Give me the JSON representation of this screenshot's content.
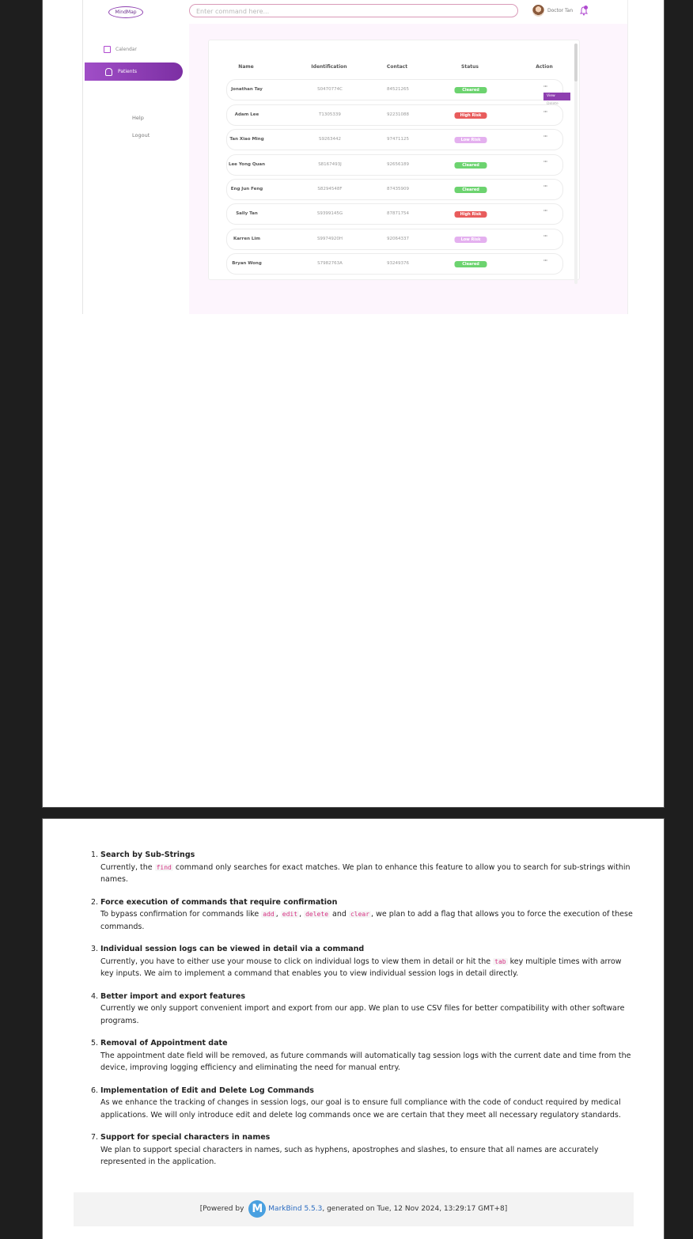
{
  "app": {
    "logo": "MindMap",
    "command_placeholder": "Enter command here...",
    "user_name": "Doctor Tan"
  },
  "sidebar": {
    "calendar": "Calendar",
    "patients": "Patients",
    "help": "Help",
    "logout": "Logout"
  },
  "table": {
    "headers": [
      "Name",
      "Identification",
      "Contact",
      "Status",
      "Action"
    ],
    "rows": [
      {
        "name": "Jonathan Tay",
        "id": "S0470774C",
        "contact": "84521265",
        "status": "Cleared"
      },
      {
        "name": "Adam Lee",
        "id": "T1305339",
        "contact": "92231088",
        "status": "High Risk"
      },
      {
        "name": "Tan Xiao Ming",
        "id": "S9263442",
        "contact": "97471125",
        "status": "Low Risk"
      },
      {
        "name": "Lee Yong Quan",
        "id": "S8167493J",
        "contact": "92656189",
        "status": "Cleared"
      },
      {
        "name": "Eng Jun Feng",
        "id": "S8294548F",
        "contact": "87435909",
        "status": "Cleared"
      },
      {
        "name": "Sally Tan",
        "id": "S9399145G",
        "contact": "87871754",
        "status": "High Risk"
      },
      {
        "name": "Karren Lim",
        "id": "S9974920H",
        "contact": "92064337",
        "status": "Low Risk"
      },
      {
        "name": "Bryan Wong",
        "id": "S7982763A",
        "contact": "93249376",
        "status": "Cleared"
      }
    ],
    "action_glyph": "···",
    "menu_view": "View",
    "menu_delete": "Delete"
  },
  "status_colors": {
    "Cleared": "#6cd36f",
    "High Risk": "#e85c5c",
    "Low Risk": "#e4b0ef"
  },
  "features": [
    {
      "num": "1.",
      "title": "Search by Sub-Strings",
      "parts": [
        "Currently, the ",
        {
          "code": "find"
        },
        " command only searches for exact matches. We plan to enhance this feature to allow you to search for sub-strings within names."
      ]
    },
    {
      "num": "2.",
      "title": "Force execution of commands that require confirmation",
      "parts": [
        "To bypass confirmation for commands like ",
        {
          "code": "add"
        },
        ", ",
        {
          "code": "edit"
        },
        ", ",
        {
          "code": "delete"
        },
        " and ",
        {
          "code": "clear"
        },
        ", we plan to add a flag that allows you to force the execution of these commands."
      ]
    },
    {
      "num": "3.",
      "title": "Individual session logs can be viewed in detail via a command",
      "parts": [
        "Currently, you have to either use your mouse to click on individual logs to view them in detail or hit the ",
        {
          "code": "tab"
        },
        " key multiple times with arrow key inputs. We aim to implement a command that enables you to view individual session logs in detail directly."
      ]
    },
    {
      "num": "4.",
      "title": "Better import and export features",
      "parts": [
        "Currently we only support convenient import and export from our app. We plan to use CSV files for better compatibility with other software programs."
      ]
    },
    {
      "num": "5.",
      "title": "Removal of Appointment date",
      "parts": [
        "The appointment date field will be removed, as future commands will automatically tag session logs with the current date and time from the device, improving logging efficiency and eliminating the need for manual entry."
      ]
    },
    {
      "num": "6.",
      "title": "Implementation of Edit and Delete Log Commands",
      "parts": [
        "As we enhance the tracking of changes in session logs, our goal is to ensure full compliance with the code of conduct required by medical applications. We will only introduce edit and delete log commands once we are certain that they meet all necessary regulatory standards."
      ]
    },
    {
      "num": "7.",
      "title": "Support for special characters in names",
      "parts": [
        "We plan to support special characters in names, such as hyphens, apostrophes and slashes, to ensure that all names are accurately represented in the application."
      ]
    }
  ],
  "footer": {
    "prefix": "[Powered by",
    "logo_letter": "M",
    "link": "MarkBind 5.5.3",
    "suffix": ", generated on Tue, 12 Nov 2024, 13:29:17 GMT+8]"
  }
}
